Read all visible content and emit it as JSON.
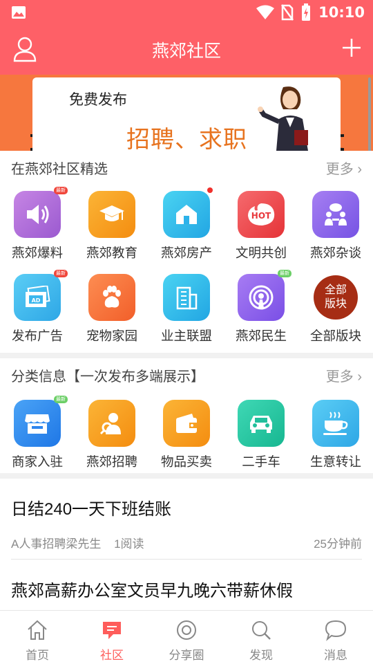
{
  "status_bar": {
    "time": "10:10"
  },
  "header": {
    "title": "燕郊社区"
  },
  "banner": {
    "line1": "免费发布",
    "line2": "招聘、求职"
  },
  "featured": {
    "heading": "在燕郊社区精选",
    "more": "更多",
    "items": [
      {
        "label": "燕郊爆料",
        "icon": "speaker-icon",
        "badge": "最新",
        "color": "#b06fd8"
      },
      {
        "label": "燕郊教育",
        "icon": "graduation-cap-icon",
        "color": "#f9a21c"
      },
      {
        "label": "燕郊房产",
        "icon": "house-icon",
        "color": "#2cc3ea"
      },
      {
        "label": "文明共创",
        "icon": "hot-icon",
        "color": "#f04b4f"
      },
      {
        "label": "燕郊杂谈",
        "icon": "chat-people-icon",
        "color": "#8a66ea"
      },
      {
        "label": "发布广告",
        "icon": "ad-icon",
        "badge": "最新",
        "color": "#3dbff0"
      },
      {
        "label": "宠物家园",
        "icon": "paw-icon",
        "color": "#fb7a3e"
      },
      {
        "label": "业主联盟",
        "icon": "building-icon",
        "color": "#3dbff0"
      },
      {
        "label": "燕郊民生",
        "icon": "podcast-icon",
        "badge": "最新",
        "color": "#8d62ea"
      },
      {
        "label": "全部版块",
        "icon": "all-sections-icon",
        "icon_text": "全部版块",
        "color": "#a52e14"
      }
    ]
  },
  "classified": {
    "heading": "分类信息【一次发布多端展示】",
    "more": "更多",
    "items": [
      {
        "label": "商家入驻",
        "icon": "shop-icon",
        "badge": "最新",
        "color": "#2f8ef0"
      },
      {
        "label": "燕郊招聘",
        "icon": "recruit-icon",
        "color": "#f9a21c"
      },
      {
        "label": "物品买卖",
        "icon": "wallet-icon",
        "color": "#f9a21c"
      },
      {
        "label": "二手车",
        "icon": "car-icon",
        "color": "#24c7a3"
      },
      {
        "label": "生意转让",
        "icon": "coffee-cup-icon",
        "color": "#3dbff0"
      }
    ]
  },
  "articles": [
    {
      "title": "日结240一天下班结账",
      "author": "A人事招聘梁先生",
      "reads": "1阅读",
      "time": "25分钟前"
    },
    {
      "title": "燕郊高薪办公室文员早九晚六带薪休假"
    }
  ],
  "tabs": [
    {
      "label": "首页",
      "icon": "home-icon",
      "active": false
    },
    {
      "label": "社区",
      "icon": "community-chat-icon",
      "active": true
    },
    {
      "label": "分享圈",
      "icon": "share-circle-icon",
      "active": false
    },
    {
      "label": "发现",
      "icon": "discover-search-icon",
      "active": false
    },
    {
      "label": "消息",
      "icon": "message-icon",
      "active": false
    }
  ],
  "colors": {
    "primary": "#fe6067",
    "banner": "#f6773e",
    "active_tab": "#fe5d5b"
  }
}
